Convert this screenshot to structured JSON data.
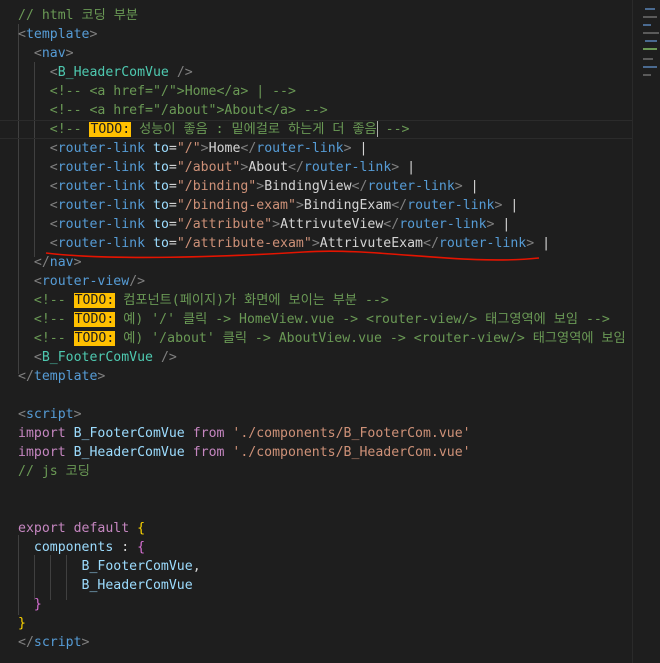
{
  "editor": {
    "lines": [
      {
        "tokens": [
          {
            "t": "// html 코딩 부분",
            "c": "t-comment"
          }
        ]
      },
      {
        "tokens": [
          {
            "t": "<",
            "c": "t-punc"
          },
          {
            "t": "template",
            "c": "t-kw2"
          },
          {
            "t": ">",
            "c": "t-punc"
          }
        ]
      },
      {
        "tokens": [
          {
            "t": "  "
          },
          {
            "t": "<",
            "c": "t-punc"
          },
          {
            "t": "nav",
            "c": "t-kw2"
          },
          {
            "t": ">",
            "c": "t-punc"
          }
        ]
      },
      {
        "tokens": [
          {
            "t": "    "
          },
          {
            "t": "<",
            "c": "t-punc"
          },
          {
            "t": "B_HeaderComVue",
            "c": "t-tag"
          },
          {
            "t": " />",
            "c": "t-punc"
          }
        ]
      },
      {
        "tokens": [
          {
            "t": "    "
          },
          {
            "t": "<!-- <a href=\"/\">Home</a> | -->",
            "c": "t-comment"
          }
        ]
      },
      {
        "tokens": [
          {
            "t": "    "
          },
          {
            "t": "<!-- <a href=\"/about\">About</a> -->",
            "c": "t-comment"
          }
        ]
      },
      {
        "active": true,
        "tokens": [
          {
            "t": "    "
          },
          {
            "t": "<!-- ",
            "c": "t-comment"
          },
          {
            "t": "TODO:",
            "c": "t-todo"
          },
          {
            "t": " 성능이 좋음 : 밑에걸로 하는게 더 좋음",
            "c": "t-comment"
          },
          {
            "t": "",
            "cursor": true
          },
          {
            "t": " -->",
            "c": "t-comment"
          }
        ]
      },
      {
        "tokens": [
          {
            "t": "    "
          },
          {
            "t": "<",
            "c": "t-punc"
          },
          {
            "t": "router-link",
            "c": "t-kw2"
          },
          {
            "t": " to",
            "c": "t-attr"
          },
          {
            "t": "=",
            "c": "t-text"
          },
          {
            "t": "\"/\"",
            "c": "t-str"
          },
          {
            "t": ">",
            "c": "t-punc"
          },
          {
            "t": "Home",
            "c": "t-text"
          },
          {
            "t": "</",
            "c": "t-punc"
          },
          {
            "t": "router-link",
            "c": "t-kw2"
          },
          {
            "t": ">",
            "c": "t-punc"
          },
          {
            "t": " |",
            "c": "t-text"
          }
        ]
      },
      {
        "tokens": [
          {
            "t": "    "
          },
          {
            "t": "<",
            "c": "t-punc"
          },
          {
            "t": "router-link",
            "c": "t-kw2"
          },
          {
            "t": " to",
            "c": "t-attr"
          },
          {
            "t": "=",
            "c": "t-text"
          },
          {
            "t": "\"/about\"",
            "c": "t-str"
          },
          {
            "t": ">",
            "c": "t-punc"
          },
          {
            "t": "About",
            "c": "t-text"
          },
          {
            "t": "</",
            "c": "t-punc"
          },
          {
            "t": "router-link",
            "c": "t-kw2"
          },
          {
            "t": ">",
            "c": "t-punc"
          },
          {
            "t": " |",
            "c": "t-text"
          }
        ]
      },
      {
        "tokens": [
          {
            "t": "    "
          },
          {
            "t": "<",
            "c": "t-punc"
          },
          {
            "t": "router-link",
            "c": "t-kw2"
          },
          {
            "t": " to",
            "c": "t-attr"
          },
          {
            "t": "=",
            "c": "t-text"
          },
          {
            "t": "\"/binding\"",
            "c": "t-str"
          },
          {
            "t": ">",
            "c": "t-punc"
          },
          {
            "t": "BindingView",
            "c": "t-text"
          },
          {
            "t": "</",
            "c": "t-punc"
          },
          {
            "t": "router-link",
            "c": "t-kw2"
          },
          {
            "t": ">",
            "c": "t-punc"
          },
          {
            "t": " |",
            "c": "t-text"
          }
        ]
      },
      {
        "tokens": [
          {
            "t": "    "
          },
          {
            "t": "<",
            "c": "t-punc"
          },
          {
            "t": "router-link",
            "c": "t-kw2"
          },
          {
            "t": " to",
            "c": "t-attr"
          },
          {
            "t": "=",
            "c": "t-text"
          },
          {
            "t": "\"/binding-exam\"",
            "c": "t-str"
          },
          {
            "t": ">",
            "c": "t-punc"
          },
          {
            "t": "BindingExam",
            "c": "t-text"
          },
          {
            "t": "</",
            "c": "t-punc"
          },
          {
            "t": "router-link",
            "c": "t-kw2"
          },
          {
            "t": ">",
            "c": "t-punc"
          },
          {
            "t": " |",
            "c": "t-text"
          }
        ]
      },
      {
        "tokens": [
          {
            "t": "    "
          },
          {
            "t": "<",
            "c": "t-punc"
          },
          {
            "t": "router-link",
            "c": "t-kw2"
          },
          {
            "t": " to",
            "c": "t-attr"
          },
          {
            "t": "=",
            "c": "t-text"
          },
          {
            "t": "\"/attribute\"",
            "c": "t-str"
          },
          {
            "t": ">",
            "c": "t-punc"
          },
          {
            "t": "AttrivuteView",
            "c": "t-text"
          },
          {
            "t": "</",
            "c": "t-punc"
          },
          {
            "t": "router-link",
            "c": "t-kw2"
          },
          {
            "t": ">",
            "c": "t-punc"
          },
          {
            "t": " |",
            "c": "t-text"
          }
        ]
      },
      {
        "tokens": [
          {
            "t": "    "
          },
          {
            "t": "<",
            "c": "t-punc"
          },
          {
            "t": "router-link",
            "c": "t-kw2"
          },
          {
            "t": " to",
            "c": "t-attr"
          },
          {
            "t": "=",
            "c": "t-text"
          },
          {
            "t": "\"/attribute-exam\"",
            "c": "t-str"
          },
          {
            "t": ">",
            "c": "t-punc"
          },
          {
            "t": "AttrivuteExam",
            "c": "t-text"
          },
          {
            "t": "</",
            "c": "t-punc"
          },
          {
            "t": "router-link",
            "c": "t-kw2"
          },
          {
            "t": ">",
            "c": "t-punc"
          },
          {
            "t": " |",
            "c": "t-text"
          }
        ]
      },
      {
        "tokens": [
          {
            "t": "  "
          },
          {
            "t": "</",
            "c": "t-punc"
          },
          {
            "t": "nav",
            "c": "t-kw2"
          },
          {
            "t": ">",
            "c": "t-punc"
          }
        ]
      },
      {
        "tokens": [
          {
            "t": "  "
          },
          {
            "t": "<",
            "c": "t-punc"
          },
          {
            "t": "router-view",
            "c": "t-kw2"
          },
          {
            "t": "/>",
            "c": "t-punc"
          }
        ]
      },
      {
        "tokens": [
          {
            "t": "  "
          },
          {
            "t": "<!-- ",
            "c": "t-comment"
          },
          {
            "t": "TODO:",
            "c": "t-todo"
          },
          {
            "t": " 컴포넌트(페이지)가 화면에 보이는 부분 -->",
            "c": "t-comment"
          }
        ]
      },
      {
        "tokens": [
          {
            "t": "  "
          },
          {
            "t": "<!-- ",
            "c": "t-comment"
          },
          {
            "t": "TODO:",
            "c": "t-todo"
          },
          {
            "t": " 예) '/' 클릭 -> HomeView.vue -> <router-view/> 태그영역에 보임 -->",
            "c": "t-comment"
          }
        ]
      },
      {
        "tokens": [
          {
            "t": "  "
          },
          {
            "t": "<!-- ",
            "c": "t-comment"
          },
          {
            "t": "TODO:",
            "c": "t-todo"
          },
          {
            "t": " 예) '/about' 클릭 -> AboutView.vue -> <router-view/> 태그영역에 보임",
            "c": "t-comment"
          }
        ]
      },
      {
        "tokens": [
          {
            "t": "  "
          },
          {
            "t": "<",
            "c": "t-punc"
          },
          {
            "t": "B_FooterComVue",
            "c": "t-tag"
          },
          {
            "t": " />",
            "c": "t-punc"
          }
        ]
      },
      {
        "tokens": [
          {
            "t": "</",
            "c": "t-punc"
          },
          {
            "t": "template",
            "c": "t-kw2"
          },
          {
            "t": ">",
            "c": "t-punc"
          }
        ]
      },
      {
        "tokens": []
      },
      {
        "tokens": [
          {
            "t": "<",
            "c": "t-punc"
          },
          {
            "t": "script",
            "c": "t-kw2"
          },
          {
            "t": ">",
            "c": "t-punc"
          }
        ]
      },
      {
        "tokens": [
          {
            "t": "import",
            "c": "t-kw"
          },
          {
            "t": " B_FooterComVue ",
            "c": "t-var"
          },
          {
            "t": "from",
            "c": "t-kw"
          },
          {
            "t": " "
          },
          {
            "t": "'./components/B_FooterCom.vue'",
            "c": "t-str"
          }
        ]
      },
      {
        "tokens": [
          {
            "t": "import",
            "c": "t-kw"
          },
          {
            "t": " B_HeaderComVue ",
            "c": "t-var"
          },
          {
            "t": "from",
            "c": "t-kw"
          },
          {
            "t": " "
          },
          {
            "t": "'./components/B_HeaderCom.vue'",
            "c": "t-str"
          }
        ]
      },
      {
        "tokens": [
          {
            "t": "// js 코딩",
            "c": "t-comment"
          }
        ]
      },
      {
        "tokens": []
      },
      {
        "tokens": []
      },
      {
        "tokens": [
          {
            "t": "export",
            "c": "t-kw"
          },
          {
            "t": " "
          },
          {
            "t": "default",
            "c": "t-kw"
          },
          {
            "t": " "
          },
          {
            "t": "{",
            "c": "t-brace"
          }
        ]
      },
      {
        "tokens": [
          {
            "t": "  "
          },
          {
            "t": "components",
            "c": "t-var"
          },
          {
            "t": " : ",
            "c": "t-text"
          },
          {
            "t": "{",
            "c": "t-brace2"
          }
        ]
      },
      {
        "tokens": [
          {
            "t": "        "
          },
          {
            "t": "B_FooterComVue",
            "c": "t-var"
          },
          {
            "t": ",",
            "c": "t-text"
          }
        ]
      },
      {
        "tokens": [
          {
            "t": "        "
          },
          {
            "t": "B_HeaderComVue",
            "c": "t-var"
          }
        ]
      },
      {
        "tokens": [
          {
            "t": "  "
          },
          {
            "t": "}",
            "c": "t-brace2"
          }
        ]
      },
      {
        "tokens": [
          {
            "t": "}",
            "c": "t-brace"
          }
        ]
      },
      {
        "tokens": [
          {
            "t": "</",
            "c": "t-punc"
          },
          {
            "t": "script",
            "c": "t-kw2"
          },
          {
            "t": ">",
            "c": "t-punc"
          }
        ]
      }
    ],
    "annotation_color": "#e51400",
    "todo_color": "#ffc000"
  }
}
